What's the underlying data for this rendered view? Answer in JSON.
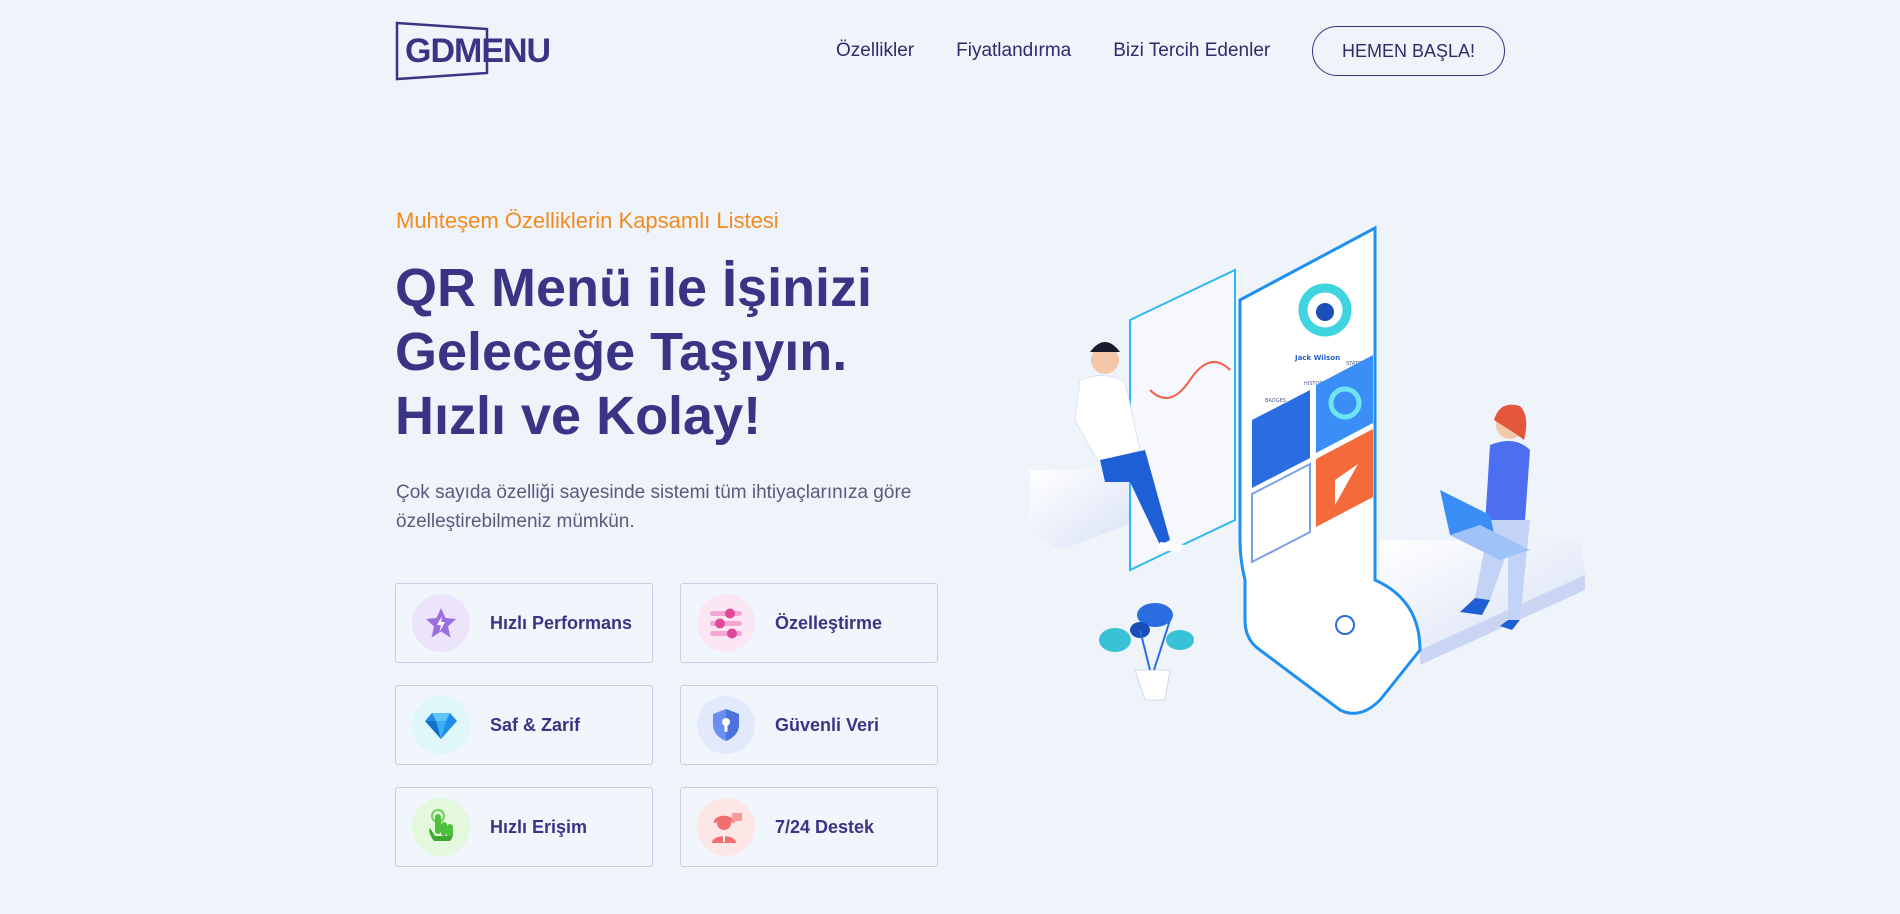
{
  "brand": {
    "logo_text": "GDMENU",
    "logo_color": "#3a3485"
  },
  "nav": {
    "links": [
      {
        "label": "Özellikler"
      },
      {
        "label": "Fiyatlandırma"
      },
      {
        "label": "Bizi Tercih Edenler"
      }
    ],
    "cta_label": "HEMEN BAŞLA!"
  },
  "hero": {
    "eyebrow": "Muhteşem Özelliklerin Kapsamlı Listesi",
    "headline_lines": [
      "QR Menü ile İşinizi",
      "Geleceğe Taşıyın.",
      "Hızlı ve Kolay!"
    ],
    "lead": "Çok sayıda özelliği sayesinde sistemi tüm ihtiyaçlarınıza göre özelleştirebilmeniz mümkün."
  },
  "features": [
    {
      "label": "Hızlı Performans",
      "icon": "star-bolt-icon",
      "bg": "#ece4fb"
    },
    {
      "label": "Özelleştirme",
      "icon": "sliders-icon",
      "bg": "#fbe6f3"
    },
    {
      "label": "Saf & Zarif",
      "icon": "diamond-icon",
      "bg": "#dff6fb"
    },
    {
      "label": "Güvenli Veri",
      "icon": "shield-lock-icon",
      "bg": "#e1e9fb"
    },
    {
      "label": "Hızlı Erişim",
      "icon": "hand-tap-icon",
      "bg": "#e3f8dd"
    },
    {
      "label": "7/24 Destek",
      "icon": "support-agent-icon",
      "bg": "#fde6e6"
    }
  ],
  "illustration": {
    "profile_name": "Jack Wilson",
    "tabs": [
      "BADGES",
      "HISTORY",
      "STATS"
    ]
  },
  "colors": {
    "accent": "#f28a1d",
    "primary": "#3a3485",
    "background": "#eff4fb"
  }
}
